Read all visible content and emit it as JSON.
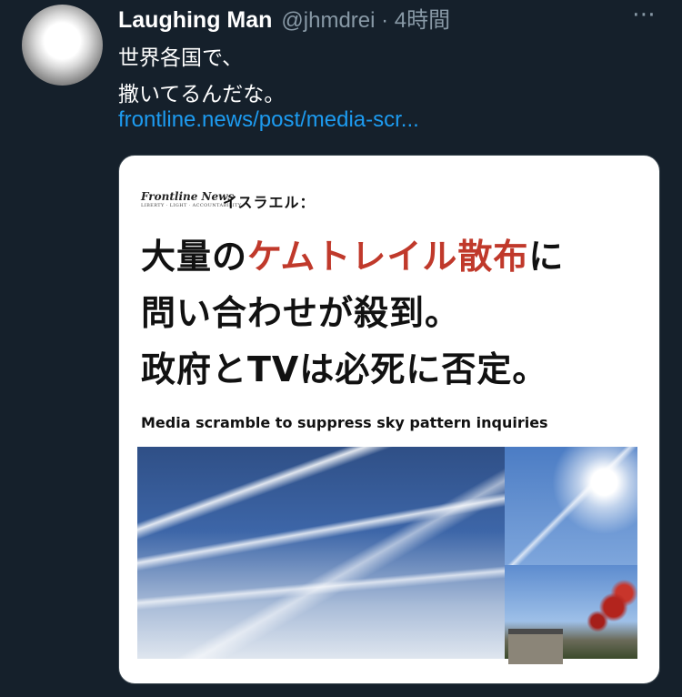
{
  "tweet": {
    "author_name": "Laughing Man",
    "handle_time": "@jhmdrei · 4時間",
    "more_icon": "⋯",
    "text_line1": "世界各国で、",
    "text_line2": "撒いてるんだな。",
    "link": "frontline.news/post/media-scr..."
  },
  "card": {
    "brand": "Frontline News",
    "brand_sub": "LIBERTY · LIGHT · ACCOUNTABILITY",
    "tag": "イスラエル：",
    "headline_part1": "大量の",
    "headline_red": "ケムトレイル散布",
    "headline_part2": "に",
    "headline_line2": "問い合わせが殺到。",
    "headline_line3": "政府とTVは必死に否定。",
    "subline": "Media scramble to suppress sky pattern inquiries"
  },
  "colors": {
    "background": "#15202b",
    "link": "#1d9bf0",
    "muted": "#8899a6",
    "headline_accent": "#c0392b"
  }
}
